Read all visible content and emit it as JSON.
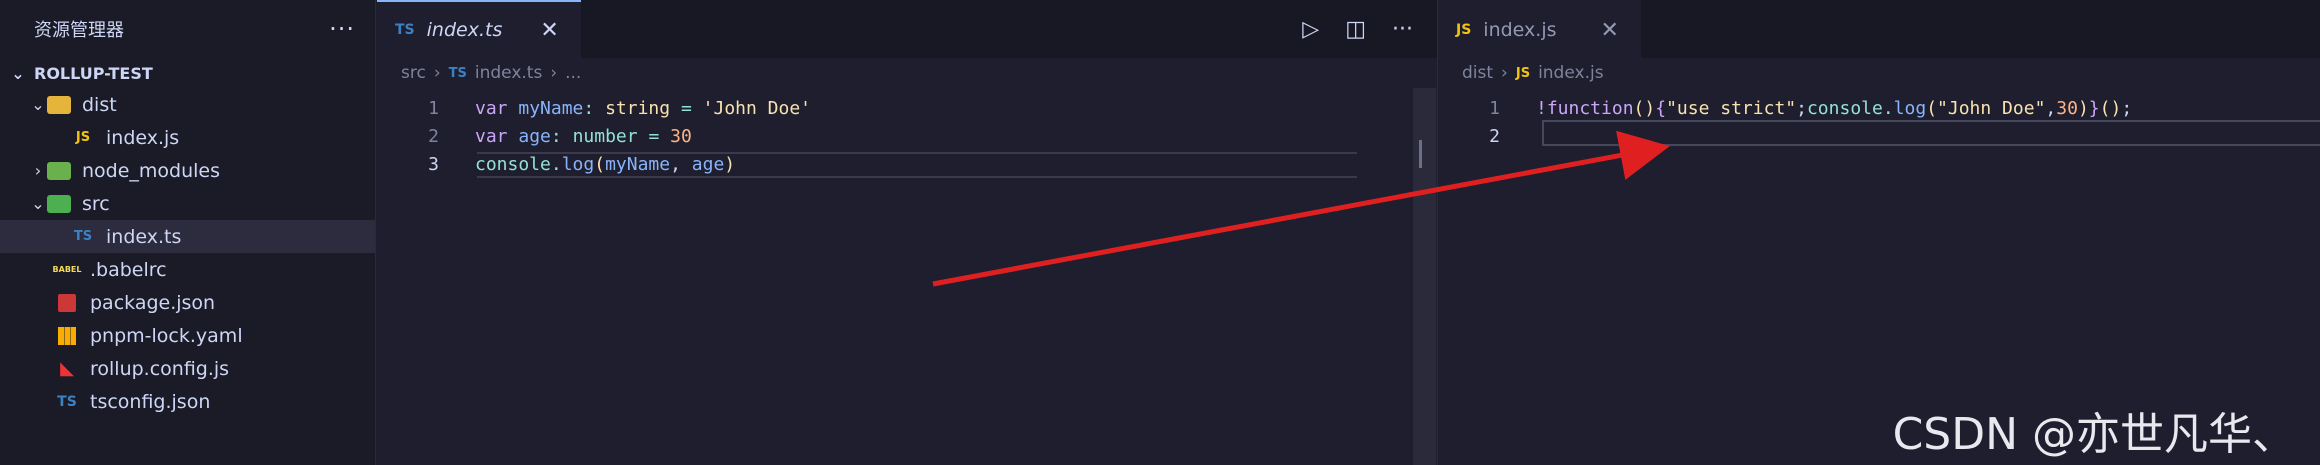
{
  "explorer": {
    "title": "资源管理器",
    "more": "···",
    "root": "ROLLUP-TEST",
    "items": [
      {
        "label": "dist",
        "icon": "folder-dist-icon"
      },
      {
        "label": "index.js",
        "icon": "js-file-icon",
        "glyph": "JS"
      },
      {
        "label": "node_modules",
        "icon": "folder-node-modules-icon"
      },
      {
        "label": "src",
        "icon": "folder-src-icon"
      },
      {
        "label": "index.ts",
        "icon": "ts-file-icon",
        "glyph": "TS"
      },
      {
        "label": ".babelrc",
        "icon": "babel-icon",
        "glyph": "BABEL"
      },
      {
        "label": "package.json",
        "icon": "npm-icon"
      },
      {
        "label": "pnpm-lock.yaml",
        "icon": "pnpm-icon"
      },
      {
        "label": "rollup.config.js",
        "icon": "rollup-icon"
      },
      {
        "label": "tsconfig.json",
        "icon": "tsconfig-icon",
        "glyph": "TS"
      }
    ]
  },
  "left_editor": {
    "tab": {
      "lang": "TS",
      "name": "index.ts",
      "close": "✕"
    },
    "actions": {
      "run": "▷",
      "split": "◫",
      "more": "···"
    },
    "breadcrumb": {
      "folder": "src",
      "lang": "TS",
      "file": "index.ts",
      "tail": "..."
    },
    "lines": [
      {
        "n": "1",
        "tokens": [
          [
            "kw",
            "var"
          ],
          [
            "plain",
            " "
          ],
          [
            "var",
            "myName"
          ],
          [
            "punc",
            ": "
          ],
          [
            "type",
            "string"
          ],
          [
            "plain",
            " "
          ],
          [
            "punc",
            "="
          ],
          [
            "plain",
            " "
          ],
          [
            "str",
            "'John Doe'"
          ]
        ]
      },
      {
        "n": "2",
        "tokens": [
          [
            "kw",
            "var"
          ],
          [
            "plain",
            " "
          ],
          [
            "var",
            "age"
          ],
          [
            "punc",
            ": "
          ],
          [
            "typ2",
            "number"
          ],
          [
            "plain",
            " "
          ],
          [
            "punc",
            "="
          ],
          [
            "plain",
            " "
          ],
          [
            "num",
            "30"
          ]
        ]
      },
      {
        "n": "3",
        "tokens": [
          [
            "obj",
            "console"
          ],
          [
            "punc",
            "."
          ],
          [
            "fn",
            "log"
          ],
          [
            "type",
            "("
          ],
          [
            "var",
            "myName"
          ],
          [
            "plain",
            ", "
          ],
          [
            "var",
            "age"
          ],
          [
            "type",
            ")"
          ]
        ]
      }
    ]
  },
  "right_editor": {
    "tab": {
      "lang": "JS",
      "name": "index.js",
      "close": "✕"
    },
    "breadcrumb": {
      "folder": "dist",
      "lang": "JS",
      "file": "index.js"
    },
    "lines": [
      {
        "n": "1",
        "tokens": [
          [
            "kw",
            "!function"
          ],
          [
            "type",
            "()"
          ],
          [
            "kw",
            "{"
          ],
          [
            "str",
            "\"use strict\""
          ],
          [
            "plain",
            ";"
          ],
          [
            "obj",
            "console"
          ],
          [
            "punc",
            "."
          ],
          [
            "fn",
            "log"
          ],
          [
            "type",
            "("
          ],
          [
            "str",
            "\"John Doe\""
          ],
          [
            "plain",
            ","
          ],
          [
            "num",
            "30"
          ],
          [
            "type",
            ")"
          ],
          [
            "kw",
            "}"
          ],
          [
            "type",
            "()"
          ],
          [
            "plain",
            ";"
          ]
        ]
      },
      {
        "n": "2",
        "tokens": []
      }
    ]
  },
  "annotation": {
    "arrow_color": "#e02020"
  },
  "watermark": "CSDN @亦世凡华、"
}
